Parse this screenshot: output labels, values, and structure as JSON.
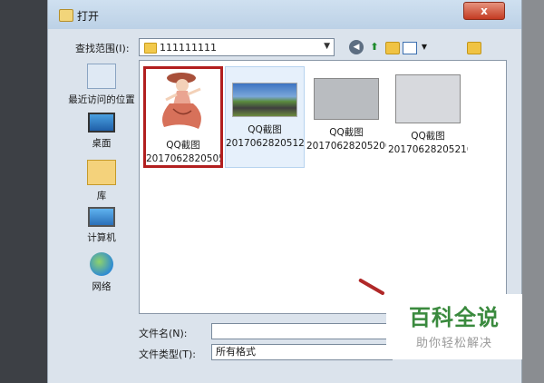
{
  "window": {
    "title": "打开",
    "close_label": "x"
  },
  "toolbar": {
    "look_in_label": "查找范围(I):",
    "look_in_value": "111111111",
    "combo_arrow": "▼",
    "back_glyph": "◀",
    "up_glyph": "⬆",
    "view_arrow": "▼"
  },
  "places": [
    {
      "label": "最近访问的位置",
      "icon": "recent-places-icon"
    },
    {
      "label": "桌面",
      "icon": "desktop-icon"
    },
    {
      "label": "库",
      "icon": "library-icon"
    },
    {
      "label": "计算机",
      "icon": "computer-icon"
    },
    {
      "label": "网络",
      "icon": "network-icon"
    }
  ],
  "files": [
    {
      "name": "QQ截图",
      "date": "2017062820505…",
      "selected": true
    },
    {
      "name": "QQ截图",
      "date": "2017062820512…",
      "selected": false
    },
    {
      "name": "QQ截图",
      "date": "20170628205200…",
      "selected": false
    },
    {
      "name": "QQ截图",
      "date": "20170628205210…",
      "selected": false
    }
  ],
  "footer": {
    "file_name_label": "文件名(N):",
    "file_name_value": "",
    "file_type_label": "文件类型(T):",
    "file_type_value": "所有格式"
  },
  "watermark": {
    "title": "百科全说",
    "subtitle": "助你轻松解决"
  },
  "colors": {
    "accent_selection": "#b21f1f",
    "watermark_green": "#3a8a3e"
  }
}
